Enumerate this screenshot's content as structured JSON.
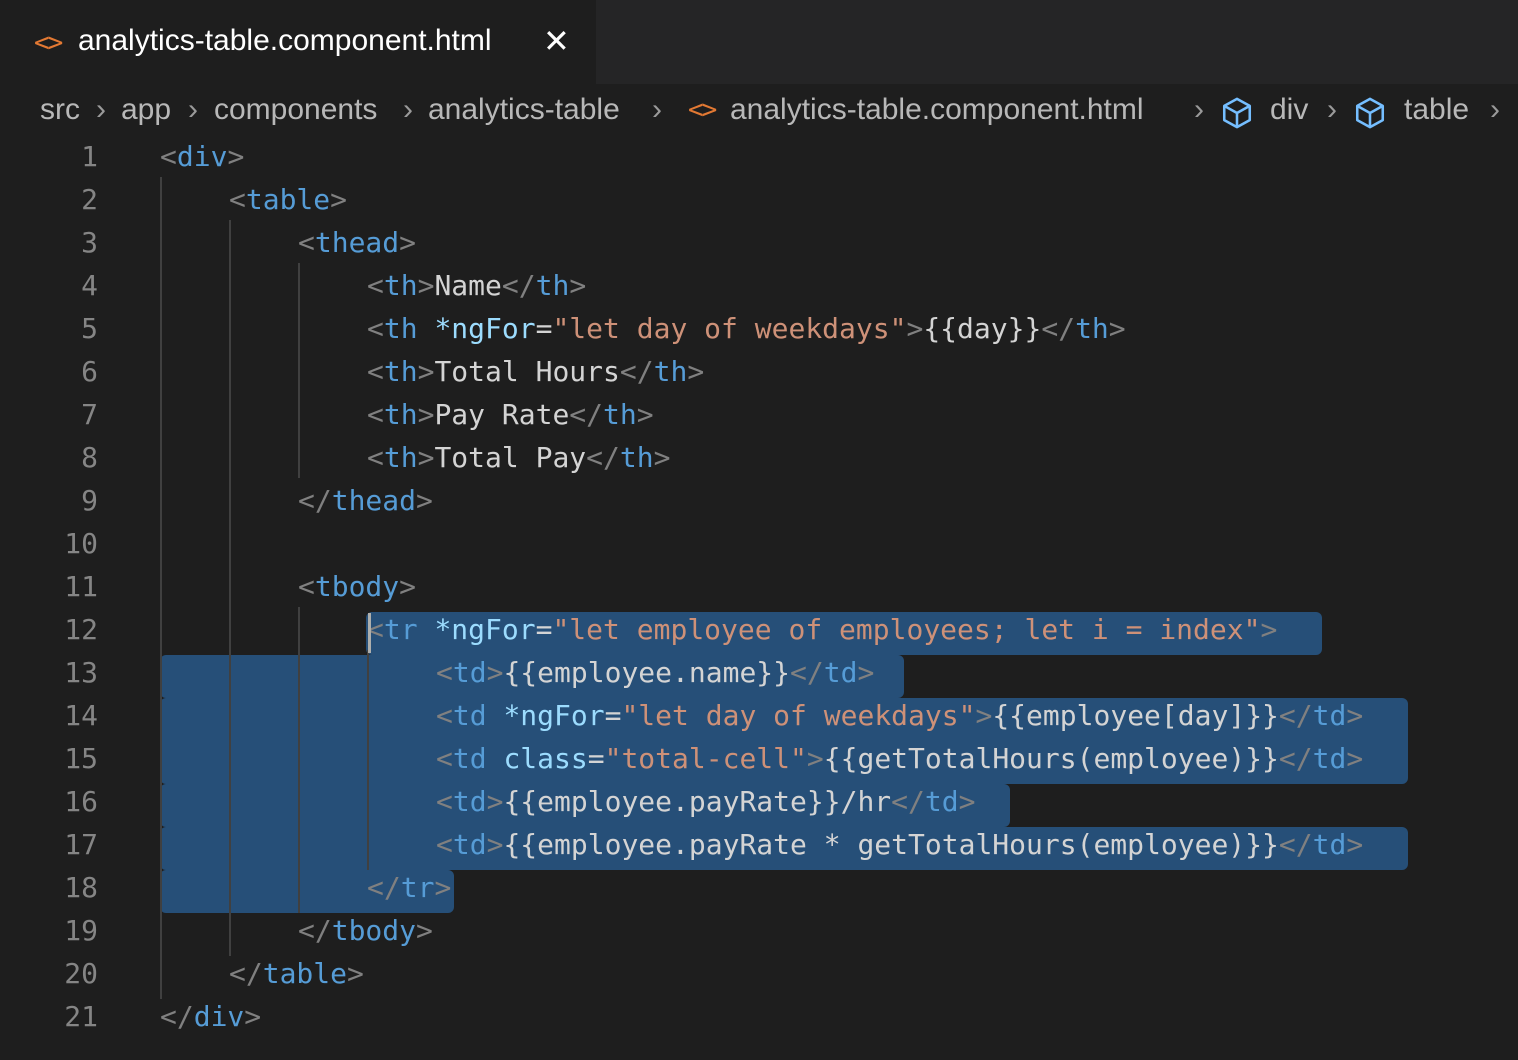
{
  "tab": {
    "title": "analytics-table.component.html",
    "icon": "html-file-icon",
    "close": "✕"
  },
  "breadcrumb": {
    "items": [
      "src",
      "app",
      "components",
      "analytics-table",
      "analytics-table.component.html",
      "div",
      "table"
    ]
  },
  "editor": {
    "line_numbers": [
      "1",
      "2",
      "3",
      "4",
      "5",
      "6",
      "7",
      "8",
      "9",
      "10",
      "11",
      "12",
      "13",
      "14",
      "15",
      "16",
      "17",
      "18",
      "19",
      "20",
      "21"
    ],
    "lines": [
      [
        [
          "p",
          "<"
        ],
        [
          "t",
          "div"
        ],
        [
          "p",
          ">"
        ]
      ],
      [
        [
          "p",
          "<"
        ],
        [
          "t",
          "table"
        ],
        [
          "p",
          ">"
        ]
      ],
      [
        [
          "p",
          "<"
        ],
        [
          "t",
          "thead"
        ],
        [
          "p",
          ">"
        ]
      ],
      [
        [
          "p",
          "<"
        ],
        [
          "t",
          "th"
        ],
        [
          "p",
          ">"
        ],
        [
          "x",
          "Name"
        ],
        [
          "p",
          "</"
        ],
        [
          "t",
          "th"
        ],
        [
          "p",
          ">"
        ]
      ],
      [
        [
          "p",
          "<"
        ],
        [
          "t",
          "th"
        ],
        [
          "x",
          " "
        ],
        [
          "a",
          "*ngFor"
        ],
        [
          "x",
          "="
        ],
        [
          "s",
          "\"let day of weekdays\""
        ],
        [
          "p",
          ">"
        ],
        [
          "x",
          "{{day}}"
        ],
        [
          "p",
          "</"
        ],
        [
          "t",
          "th"
        ],
        [
          "p",
          ">"
        ]
      ],
      [
        [
          "p",
          "<"
        ],
        [
          "t",
          "th"
        ],
        [
          "p",
          ">"
        ],
        [
          "x",
          "Total Hours"
        ],
        [
          "p",
          "</"
        ],
        [
          "t",
          "th"
        ],
        [
          "p",
          ">"
        ]
      ],
      [
        [
          "p",
          "<"
        ],
        [
          "t",
          "th"
        ],
        [
          "p",
          ">"
        ],
        [
          "x",
          "Pay Rate"
        ],
        [
          "p",
          "</"
        ],
        [
          "t",
          "th"
        ],
        [
          "p",
          ">"
        ]
      ],
      [
        [
          "p",
          "<"
        ],
        [
          "t",
          "th"
        ],
        [
          "p",
          ">"
        ],
        [
          "x",
          "Total Pay"
        ],
        [
          "p",
          "</"
        ],
        [
          "t",
          "th"
        ],
        [
          "p",
          ">"
        ]
      ],
      [
        [
          "p",
          "</"
        ],
        [
          "t",
          "thead"
        ],
        [
          "p",
          ">"
        ]
      ],
      [],
      [
        [
          "p",
          "<"
        ],
        [
          "t",
          "tbody"
        ],
        [
          "p",
          ">"
        ]
      ],
      [
        [
          "p",
          "<"
        ],
        [
          "t",
          "tr"
        ],
        [
          "x",
          " "
        ],
        [
          "a",
          "*ngFor"
        ],
        [
          "x",
          "="
        ],
        [
          "s",
          "\"let employee of employees; let i = index\""
        ],
        [
          "p",
          ">"
        ]
      ],
      [
        [
          "p",
          "<"
        ],
        [
          "t",
          "td"
        ],
        [
          "p",
          ">"
        ],
        [
          "x",
          "{{employee.name}}"
        ],
        [
          "p",
          "</"
        ],
        [
          "t",
          "td"
        ],
        [
          "p",
          ">"
        ]
      ],
      [
        [
          "p",
          "<"
        ],
        [
          "t",
          "td"
        ],
        [
          "x",
          " "
        ],
        [
          "a",
          "*ngFor"
        ],
        [
          "x",
          "="
        ],
        [
          "s",
          "\"let day of weekdays\""
        ],
        [
          "p",
          ">"
        ],
        [
          "x",
          "{{employee[day]}}"
        ],
        [
          "p",
          "</"
        ],
        [
          "t",
          "td"
        ],
        [
          "p",
          ">"
        ]
      ],
      [
        [
          "p",
          "<"
        ],
        [
          "t",
          "td"
        ],
        [
          "x",
          " "
        ],
        [
          "a",
          "class"
        ],
        [
          "x",
          "="
        ],
        [
          "s",
          "\"total-cell\""
        ],
        [
          "p",
          ">"
        ],
        [
          "x",
          "{{getTotalHours(employee)}}"
        ],
        [
          "p",
          "</"
        ],
        [
          "t",
          "td"
        ],
        [
          "p",
          ">"
        ]
      ],
      [
        [
          "p",
          "<"
        ],
        [
          "t",
          "td"
        ],
        [
          "p",
          ">"
        ],
        [
          "x",
          "{{employee.payRate}}/hr"
        ],
        [
          "p",
          "</"
        ],
        [
          "t",
          "td"
        ],
        [
          "p",
          ">"
        ]
      ],
      [
        [
          "p",
          "<"
        ],
        [
          "t",
          "td"
        ],
        [
          "p",
          ">"
        ],
        [
          "x",
          "{{employee.payRate * getTotalHours(employee)}}"
        ],
        [
          "p",
          "</"
        ],
        [
          "t",
          "td"
        ],
        [
          "p",
          ">"
        ]
      ],
      [
        [
          "p",
          "</"
        ],
        [
          "t",
          "tr"
        ],
        [
          "p",
          ">"
        ]
      ],
      [
        [
          "p",
          "</"
        ],
        [
          "t",
          "tbody"
        ],
        [
          "p",
          ">"
        ]
      ],
      [
        [
          "p",
          "</"
        ],
        [
          "t",
          "table"
        ],
        [
          "p",
          ">"
        ]
      ],
      [
        [
          "p",
          "</"
        ],
        [
          "t",
          "div"
        ],
        [
          "p",
          ">"
        ]
      ]
    ],
    "indents": [
      0,
      1,
      2,
      3,
      3,
      3,
      3,
      3,
      2,
      0,
      2,
      3,
      4,
      4,
      4,
      4,
      4,
      3,
      2,
      1,
      0
    ],
    "colors": {
      "punctuation": "#808080",
      "tag": "#569cd6",
      "attribute": "#9cdcfe",
      "string": "#ce9178",
      "text": "#d4d4d4",
      "selection": "#264f78"
    }
  }
}
